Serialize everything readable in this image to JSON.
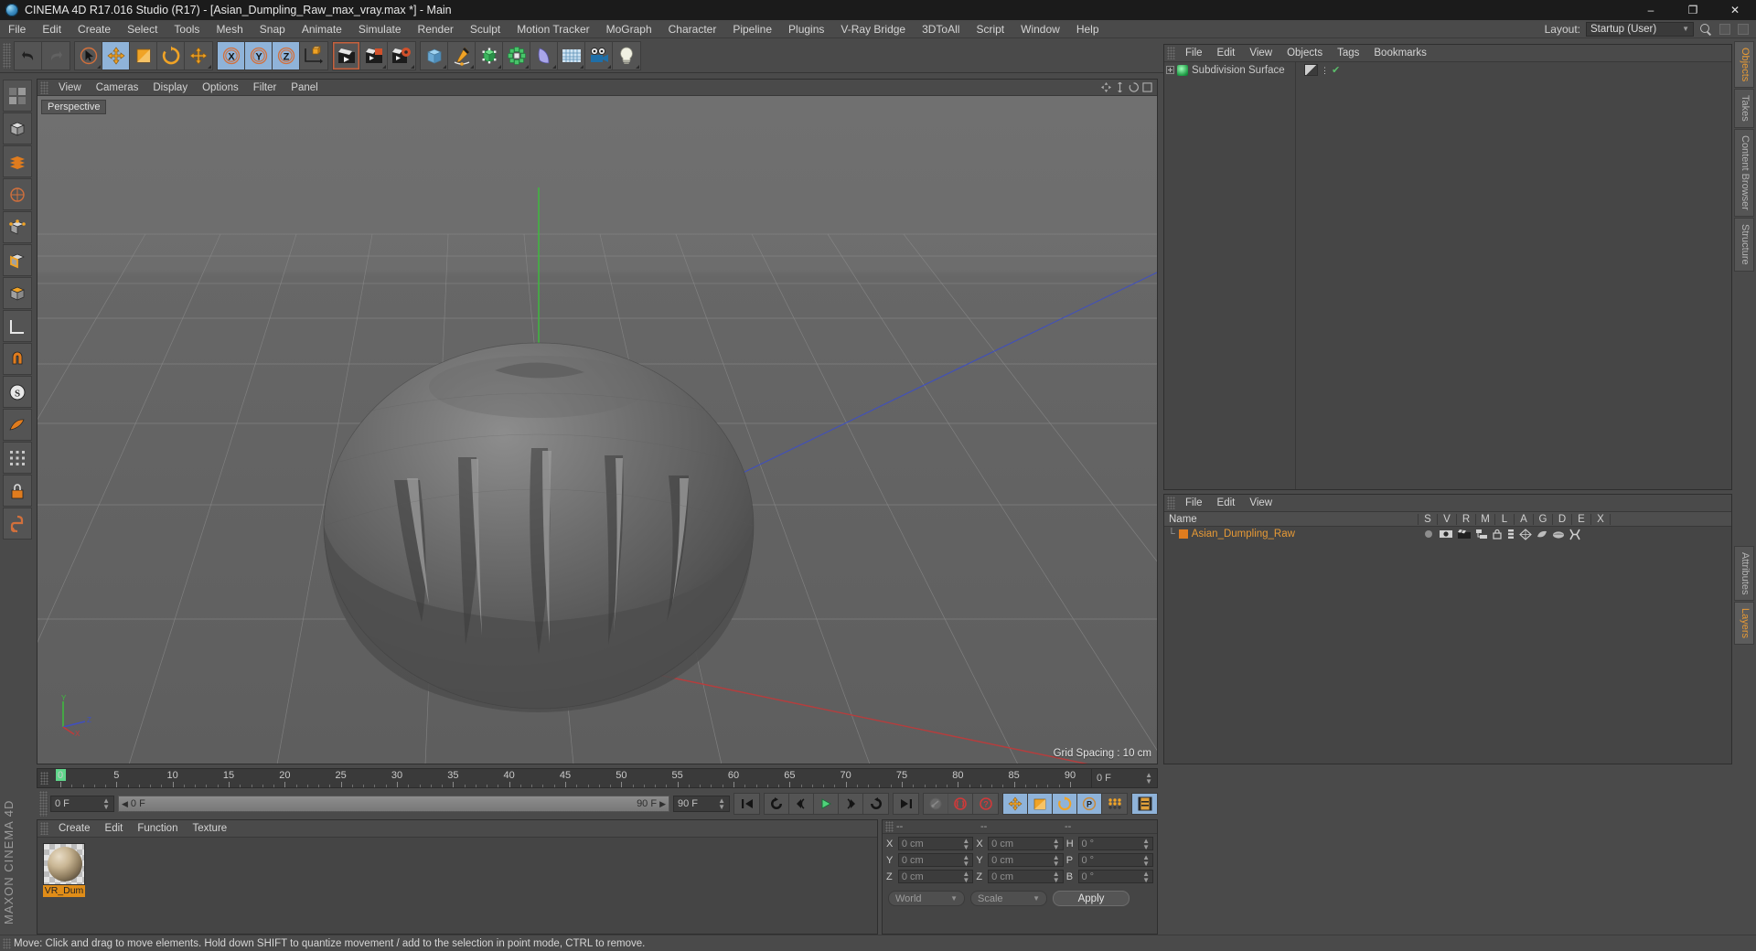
{
  "window": {
    "title": "CINEMA 4D R17.016 Studio (R17) - [Asian_Dumpling_Raw_max_vray.max *] - Main",
    "minimize": "–",
    "maximize": "❐",
    "close": "✕"
  },
  "menubar": {
    "items": [
      "File",
      "Edit",
      "Create",
      "Select",
      "Tools",
      "Mesh",
      "Snap",
      "Animate",
      "Simulate",
      "Render",
      "Sculpt",
      "Motion Tracker",
      "MoGraph",
      "Character",
      "Pipeline",
      "Plugins",
      "V-Ray Bridge",
      "3DToAll",
      "Script",
      "Window",
      "Help"
    ],
    "layout_label": "Layout:",
    "layout_value": "Startup (User)"
  },
  "toolbar": {
    "groups": [
      {
        "name": "history",
        "buttons": [
          {
            "icon": "undo-icon",
            "label": "Undo",
            "state": "normal"
          },
          {
            "icon": "redo-icon",
            "label": "Redo",
            "state": "disabled"
          }
        ]
      },
      {
        "name": "transform",
        "buttons": [
          {
            "icon": "live-selection-icon",
            "label": "Live Selection",
            "state": "normal"
          },
          {
            "icon": "move-icon",
            "label": "Move",
            "state": "active"
          },
          {
            "icon": "scale-icon",
            "label": "Scale",
            "state": "normal"
          },
          {
            "icon": "rotate-icon",
            "label": "Rotate",
            "state": "normal"
          },
          {
            "icon": "move-dup-icon",
            "label": "Move Tool",
            "state": "normal"
          }
        ]
      },
      {
        "name": "axis-locks",
        "buttons": [
          {
            "icon": "axis-x-icon",
            "label": "X Axis",
            "state": "active"
          },
          {
            "icon": "axis-y-icon",
            "label": "Y Axis",
            "state": "active"
          },
          {
            "icon": "axis-z-icon",
            "label": "Z Axis",
            "state": "active"
          },
          {
            "icon": "world-coord-icon",
            "label": "World/Object Coordinates",
            "state": "normal"
          }
        ]
      },
      {
        "name": "render",
        "buttons": [
          {
            "icon": "render-view-icon",
            "label": "Render View",
            "state": "highlight"
          },
          {
            "icon": "render-picture-viewer-icon",
            "label": "Render to Picture Viewer",
            "state": "normal"
          },
          {
            "icon": "render-settings-icon",
            "label": "Edit Render Settings",
            "state": "normal"
          }
        ]
      },
      {
        "name": "create",
        "buttons": [
          {
            "icon": "cube-primitive-icon",
            "label": "Add Cube Object",
            "state": "normal"
          },
          {
            "icon": "spline-pen-icon",
            "label": "Add Spline",
            "state": "normal"
          },
          {
            "icon": "nurbs-icon",
            "label": "Add Generator",
            "state": "normal"
          },
          {
            "icon": "array-icon",
            "label": "Add Array / Modeling Object",
            "state": "normal"
          },
          {
            "icon": "deformer-icon",
            "label": "Add Bend Deformer",
            "state": "normal"
          },
          {
            "icon": "floor-scene-icon",
            "label": "Add Floor / Scene Object",
            "state": "normal"
          },
          {
            "icon": "camera-icon",
            "label": "Add Camera",
            "state": "normal"
          },
          {
            "icon": "light-icon",
            "label": "Add Light",
            "state": "normal"
          }
        ]
      }
    ]
  },
  "viewport": {
    "menu": [
      "View",
      "Cameras",
      "Display",
      "Options",
      "Filter",
      "Panel"
    ],
    "label": "Perspective",
    "grid_spacing": "Grid Spacing : 10 cm",
    "axis_labels": {
      "x": "X",
      "y": "Y",
      "z": "Z"
    }
  },
  "object_manager": {
    "menu": [
      "File",
      "Edit",
      "View",
      "Objects",
      "Tags",
      "Bookmarks"
    ],
    "items": [
      {
        "name": "Subdivision Surface",
        "icon": "subdivision-surface-icon",
        "has_tag": true,
        "visible": true
      }
    ]
  },
  "layer_manager": {
    "menu": [
      "File",
      "Edit",
      "View"
    ],
    "columns": [
      "Name",
      "S",
      "V",
      "R",
      "M",
      "L",
      "A",
      "G",
      "D",
      "E",
      "X"
    ],
    "rows": [
      {
        "name": "Asian_Dumpling_Raw",
        "color": "#e07c1e"
      }
    ]
  },
  "timeline": {
    "ticks": [
      0,
      5,
      10,
      15,
      20,
      25,
      30,
      35,
      40,
      45,
      50,
      55,
      60,
      65,
      70,
      75,
      80,
      85,
      90
    ],
    "start": 0,
    "end": 90,
    "current_frame_field": "0 F",
    "playhead_label": "0"
  },
  "playback": {
    "current_frame": "0 F",
    "range_start": "0 F",
    "range_end": "90 F",
    "end_frame": "90 F",
    "buttons": [
      {
        "icon": "go-to-start-icon",
        "label": "Go to Start",
        "state": "normal"
      },
      {
        "icon": "play-backwards-icon",
        "label": "Play Backwards",
        "state": "normal"
      },
      {
        "icon": "prev-frame-icon",
        "label": "Go to Previous Frame",
        "state": "normal"
      },
      {
        "icon": "play-forward-icon",
        "label": "Play Forwards",
        "state": "normal"
      },
      {
        "icon": "next-frame-icon",
        "label": "Go to Next Frame",
        "state": "normal"
      },
      {
        "icon": "play-loop-icon",
        "label": "Loop Playback",
        "state": "normal"
      },
      {
        "icon": "go-to-end-icon",
        "label": "Go to End",
        "state": "normal"
      },
      {
        "icon": "autokey-toggle-icon",
        "label": "Autokeying",
        "state": "disabled"
      },
      {
        "icon": "record-key-icon",
        "label": "Record Active Objects",
        "state": "normal"
      },
      {
        "icon": "keyframe-selection-icon",
        "label": "Keyframe Selection",
        "state": "normal"
      },
      {
        "icon": "key-position-icon",
        "label": "Position",
        "state": "active"
      },
      {
        "icon": "key-scale-icon",
        "label": "Scale",
        "state": "active"
      },
      {
        "icon": "key-rotation-icon",
        "label": "Rotation",
        "state": "active"
      },
      {
        "icon": "key-param-icon",
        "label": "Parameter",
        "state": "active"
      },
      {
        "icon": "key-pla-icon",
        "label": "Point Level Animation",
        "state": "normal"
      },
      {
        "icon": "timeline-icon",
        "label": "Timeline",
        "state": "active"
      }
    ]
  },
  "material_manager": {
    "menu": [
      "Create",
      "Edit",
      "Function",
      "Texture"
    ],
    "materials": [
      {
        "name": "VR_Dum",
        "icon": "material-sphere-icon"
      }
    ]
  },
  "coordinates": {
    "headers": [
      "--",
      "--",
      "--"
    ],
    "rows": [
      {
        "pos_label": "X",
        "pos_value": "0 cm",
        "size_label": "X",
        "size_value": "0 cm",
        "rot_label": "H",
        "rot_value": "0 °"
      },
      {
        "pos_label": "Y",
        "pos_value": "0 cm",
        "size_label": "Y",
        "size_value": "0 cm",
        "rot_label": "P",
        "rot_value": "0 °"
      },
      {
        "pos_label": "Z",
        "pos_value": "0 cm",
        "size_label": "Z",
        "size_value": "0 cm",
        "rot_label": "B",
        "rot_value": "0 °"
      }
    ],
    "system": "World",
    "mode": "Scale",
    "apply": "Apply"
  },
  "status": {
    "message": "Move: Click and drag to move elements. Hold down SHIFT to quantize movement / add to the selection in point mode, CTRL to remove."
  },
  "right_tabs": [
    {
      "label": "Objects",
      "active": true
    },
    {
      "label": "Takes",
      "active": false
    },
    {
      "label": "Content Browser",
      "active": false
    },
    {
      "label": "Structure",
      "active": false
    },
    {
      "label": "Attributes",
      "active": false
    },
    {
      "label": "Layers",
      "active": true
    }
  ],
  "brand": "MAXON CINEMA 4D",
  "colors": {
    "accent_orange": "#e79a36",
    "selected_blue": "#8fb3d9",
    "panel_bg": "#454545",
    "toolbar_bg": "#4a4a4a",
    "viewport_bg": "#6a6a6a",
    "green_playhead": "#5fd68a",
    "axis_x": "#cc4444",
    "axis_y": "#44bb44",
    "axis_z": "#4455cc"
  }
}
